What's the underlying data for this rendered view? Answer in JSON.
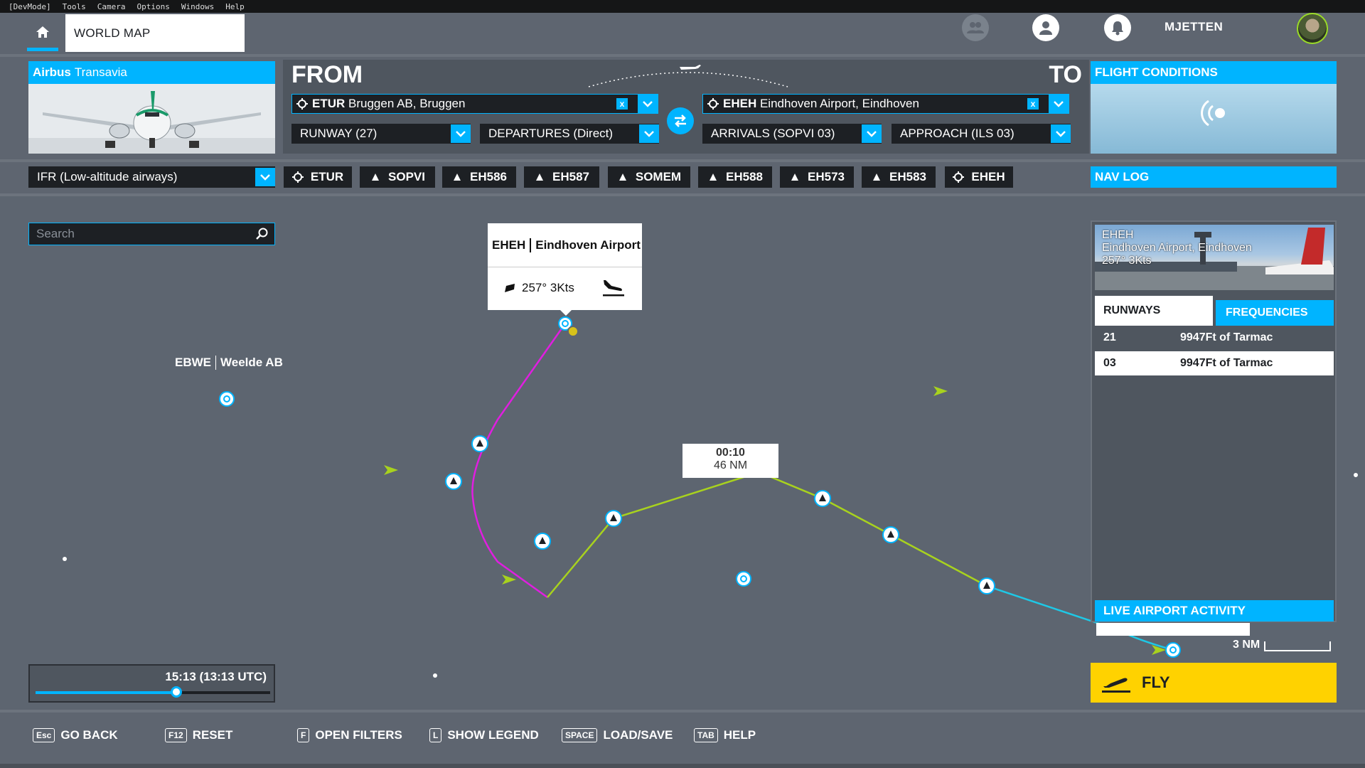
{
  "devmenu": [
    "[DevMode]",
    "Tools",
    "Camera",
    "Options",
    "Windows",
    "Help"
  ],
  "header": {
    "tab_title": "WORLD MAP",
    "username": "MJETTEN"
  },
  "aircraft": {
    "brand": "Airbus",
    "livery": "Transavia"
  },
  "route": {
    "from_label": "FROM",
    "to_label": "TO",
    "departure": {
      "icao": "ETUR",
      "name": "Bruggen AB, Bruggen"
    },
    "arrival": {
      "icao": "EHEH",
      "name": "Eindhoven Airport, Eindhoven"
    },
    "runway": "RUNWAY (27)",
    "departures": "DEPARTURES (Direct)",
    "arrivals": "ARRIVALS (SOPVI 03)",
    "approach": "APPROACH (ILS 03)"
  },
  "flight_conditions": {
    "title": "FLIGHT CONDITIONS"
  },
  "flight_plan_type": "IFR (Low-altitude airways)",
  "waypoints": [
    {
      "label": "ETUR",
      "icon": "airport-icon"
    },
    {
      "label": "SOPVI",
      "icon": "waypoint-triangle-icon"
    },
    {
      "label": "EH586",
      "icon": "waypoint-triangle-icon"
    },
    {
      "label": "EH587",
      "icon": "waypoint-triangle-icon"
    },
    {
      "label": "SOMEM",
      "icon": "waypoint-triangle-icon"
    },
    {
      "label": "EH588",
      "icon": "waypoint-triangle-icon"
    },
    {
      "label": "EH573",
      "icon": "waypoint-triangle-icon"
    },
    {
      "label": "EH583",
      "icon": "waypoint-triangle-icon"
    },
    {
      "label": "EHEH",
      "icon": "airport-icon"
    }
  ],
  "nav_log_label": "NAV LOG",
  "search": {
    "placeholder": "Search"
  },
  "map": {
    "tooltip": {
      "icao": "EHEH",
      "name": "Eindhoven Airport",
      "wind": "257° 3Kts"
    },
    "leg_tip": {
      "time": "00:10",
      "distance": "46 NM"
    },
    "label_ebwe": {
      "icao": "EBWE",
      "name": "Weelde AB"
    },
    "scale": "3 NM"
  },
  "airport_panel": {
    "icao": "EHEH",
    "name": "Eindhoven Airport, Eindhoven",
    "wind": "257° 3Kts",
    "tab_runways": "RUNWAYS",
    "tab_frequencies": "FREQUENCIES",
    "runways": [
      {
        "id": "21",
        "desc": "9947Ft of Tarmac"
      },
      {
        "id": "03",
        "desc": "9947Ft of Tarmac"
      }
    ],
    "live_activity": "LIVE AIRPORT ACTIVITY"
  },
  "fly_label": "FLY",
  "time": {
    "label": "15:13 (13:13 UTC)",
    "slider_fraction": 0.6
  },
  "bottom_hints": [
    {
      "key": "Esc",
      "label": "GO BACK"
    },
    {
      "key": "F12",
      "label": "RESET"
    },
    {
      "key": "F",
      "label": "OPEN FILTERS"
    },
    {
      "key": "L",
      "label": "SHOW LEGEND"
    },
    {
      "key": "SPACE",
      "label": "LOAD/SAVE"
    },
    {
      "key": "TAB",
      "label": "HELP"
    }
  ],
  "colors": {
    "accent": "#00b4ff",
    "departure_route": "#e01ee0",
    "enroute": "#a8d21e",
    "approach": "#1ec8e6",
    "fly": "#ffd200"
  }
}
